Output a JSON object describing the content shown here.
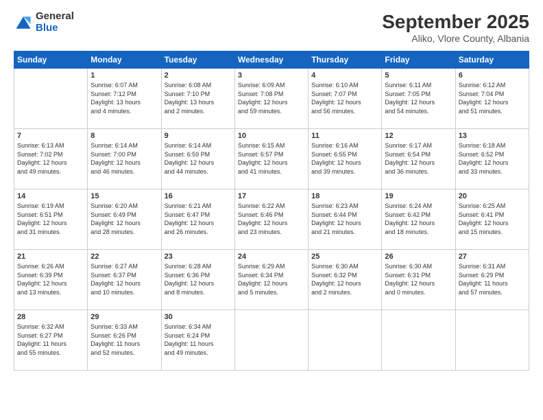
{
  "logo": {
    "general": "General",
    "blue": "Blue"
  },
  "header": {
    "month": "September 2025",
    "location": "Aliko, Vlore County, Albania"
  },
  "weekdays": [
    "Sunday",
    "Monday",
    "Tuesday",
    "Wednesday",
    "Thursday",
    "Friday",
    "Saturday"
  ],
  "weeks": [
    [
      {
        "day": "",
        "info": ""
      },
      {
        "day": "1",
        "info": "Sunrise: 6:07 AM\nSunset: 7:12 PM\nDaylight: 13 hours\nand 4 minutes."
      },
      {
        "day": "2",
        "info": "Sunrise: 6:08 AM\nSunset: 7:10 PM\nDaylight: 13 hours\nand 2 minutes."
      },
      {
        "day": "3",
        "info": "Sunrise: 6:09 AM\nSunset: 7:08 PM\nDaylight: 12 hours\nand 59 minutes."
      },
      {
        "day": "4",
        "info": "Sunrise: 6:10 AM\nSunset: 7:07 PM\nDaylight: 12 hours\nand 56 minutes."
      },
      {
        "day": "5",
        "info": "Sunrise: 6:11 AM\nSunset: 7:05 PM\nDaylight: 12 hours\nand 54 minutes."
      },
      {
        "day": "6",
        "info": "Sunrise: 6:12 AM\nSunset: 7:04 PM\nDaylight: 12 hours\nand 51 minutes."
      }
    ],
    [
      {
        "day": "7",
        "info": "Sunrise: 6:13 AM\nSunset: 7:02 PM\nDaylight: 12 hours\nand 49 minutes."
      },
      {
        "day": "8",
        "info": "Sunrise: 6:14 AM\nSunset: 7:00 PM\nDaylight: 12 hours\nand 46 minutes."
      },
      {
        "day": "9",
        "info": "Sunrise: 6:14 AM\nSunset: 6:59 PM\nDaylight: 12 hours\nand 44 minutes."
      },
      {
        "day": "10",
        "info": "Sunrise: 6:15 AM\nSunset: 6:57 PM\nDaylight: 12 hours\nand 41 minutes."
      },
      {
        "day": "11",
        "info": "Sunrise: 6:16 AM\nSunset: 6:55 PM\nDaylight: 12 hours\nand 39 minutes."
      },
      {
        "day": "12",
        "info": "Sunrise: 6:17 AM\nSunset: 6:54 PM\nDaylight: 12 hours\nand 36 minutes."
      },
      {
        "day": "13",
        "info": "Sunrise: 6:18 AM\nSunset: 6:52 PM\nDaylight: 12 hours\nand 33 minutes."
      }
    ],
    [
      {
        "day": "14",
        "info": "Sunrise: 6:19 AM\nSunset: 6:51 PM\nDaylight: 12 hours\nand 31 minutes."
      },
      {
        "day": "15",
        "info": "Sunrise: 6:20 AM\nSunset: 6:49 PM\nDaylight: 12 hours\nand 28 minutes."
      },
      {
        "day": "16",
        "info": "Sunrise: 6:21 AM\nSunset: 6:47 PM\nDaylight: 12 hours\nand 26 minutes."
      },
      {
        "day": "17",
        "info": "Sunrise: 6:22 AM\nSunset: 6:46 PM\nDaylight: 12 hours\nand 23 minutes."
      },
      {
        "day": "18",
        "info": "Sunrise: 6:23 AM\nSunset: 6:44 PM\nDaylight: 12 hours\nand 21 minutes."
      },
      {
        "day": "19",
        "info": "Sunrise: 6:24 AM\nSunset: 6:42 PM\nDaylight: 12 hours\nand 18 minutes."
      },
      {
        "day": "20",
        "info": "Sunrise: 6:25 AM\nSunset: 6:41 PM\nDaylight: 12 hours\nand 15 minutes."
      }
    ],
    [
      {
        "day": "21",
        "info": "Sunrise: 6:26 AM\nSunset: 6:39 PM\nDaylight: 12 hours\nand 13 minutes."
      },
      {
        "day": "22",
        "info": "Sunrise: 6:27 AM\nSunset: 6:37 PM\nDaylight: 12 hours\nand 10 minutes."
      },
      {
        "day": "23",
        "info": "Sunrise: 6:28 AM\nSunset: 6:36 PM\nDaylight: 12 hours\nand 8 minutes."
      },
      {
        "day": "24",
        "info": "Sunrise: 6:29 AM\nSunset: 6:34 PM\nDaylight: 12 hours\nand 5 minutes."
      },
      {
        "day": "25",
        "info": "Sunrise: 6:30 AM\nSunset: 6:32 PM\nDaylight: 12 hours\nand 2 minutes."
      },
      {
        "day": "26",
        "info": "Sunrise: 6:30 AM\nSunset: 6:31 PM\nDaylight: 12 hours\nand 0 minutes."
      },
      {
        "day": "27",
        "info": "Sunrise: 6:31 AM\nSunset: 6:29 PM\nDaylight: 11 hours\nand 57 minutes."
      }
    ],
    [
      {
        "day": "28",
        "info": "Sunrise: 6:32 AM\nSunset: 6:27 PM\nDaylight: 11 hours\nand 55 minutes."
      },
      {
        "day": "29",
        "info": "Sunrise: 6:33 AM\nSunset: 6:26 PM\nDaylight: 11 hours\nand 52 minutes."
      },
      {
        "day": "30",
        "info": "Sunrise: 6:34 AM\nSunset: 6:24 PM\nDaylight: 11 hours\nand 49 minutes."
      },
      {
        "day": "",
        "info": ""
      },
      {
        "day": "",
        "info": ""
      },
      {
        "day": "",
        "info": ""
      },
      {
        "day": "",
        "info": ""
      }
    ]
  ]
}
